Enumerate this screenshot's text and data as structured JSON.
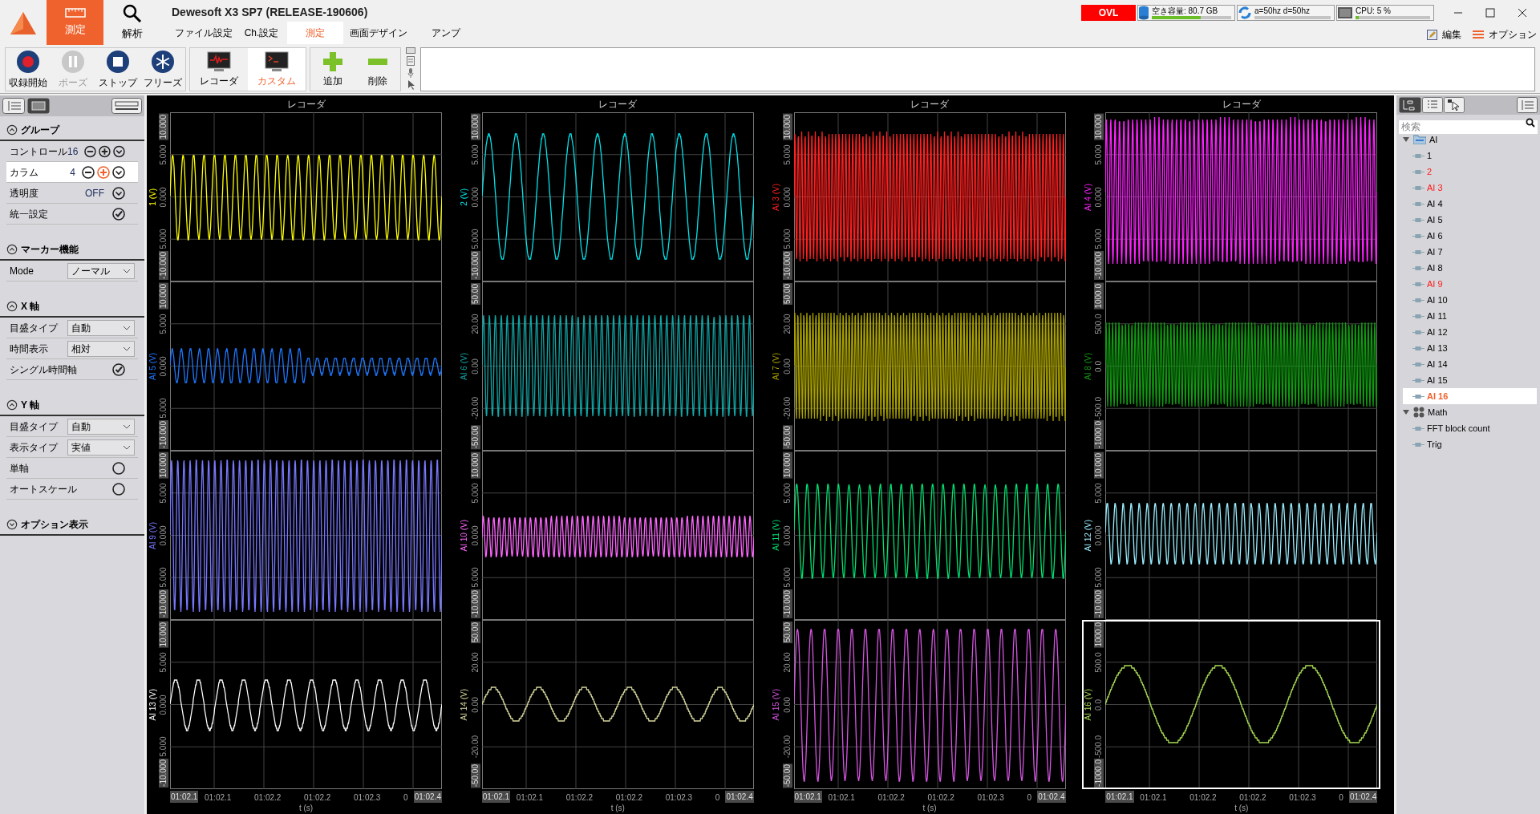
{
  "app_tabs": [
    {
      "kind": "measure",
      "label": "測定",
      "selected": true
    },
    {
      "kind": "analysis",
      "label": "解析",
      "selected": false
    }
  ],
  "window": {
    "title": "Dewesoft X3 SP7 (RELEASE-190606)"
  },
  "menu_tabs": [
    {
      "label": "ファイル設定",
      "selected": false
    },
    {
      "label": "Ch.設定",
      "selected": false
    },
    {
      "label": "測定",
      "selected": true
    },
    {
      "label": "画面デザイン",
      "selected": false
    },
    {
      "label": "アンプ",
      "selected": false
    }
  ],
  "status": {
    "alarm": "OVL",
    "meters": [
      {
        "kind": "disk",
        "label": "空き容量: 80.7 GB",
        "level": 0.62
      },
      {
        "kind": "sync",
        "label": "a=50hz d=50hz",
        "level": 0
      },
      {
        "kind": "cpu",
        "label": "CPU: 5 %",
        "level": 0.04
      }
    ]
  },
  "top_actions": [
    {
      "kind": "edit",
      "label": "編集"
    },
    {
      "kind": "options",
      "label": "オプション"
    }
  ],
  "toolbar": {
    "acquisition": [
      {
        "kind": "record",
        "label": "収録開始",
        "disabled": false
      },
      {
        "kind": "pause",
        "label": "ポーズ",
        "disabled": true
      },
      {
        "kind": "stop",
        "label": "ストップ",
        "disabled": false
      },
      {
        "kind": "freeze",
        "label": "フリーズ",
        "disabled": false
      }
    ],
    "layouts": [
      {
        "kind": "recorder",
        "label": "レコーダ",
        "selected": false
      },
      {
        "kind": "custom",
        "label": "カスタム",
        "selected": true
      }
    ],
    "edit": [
      {
        "kind": "add",
        "label": "追加"
      },
      {
        "kind": "remove",
        "label": "削除"
      }
    ]
  },
  "settings": [
    {
      "title": "グループ",
      "expanded": true,
      "rows": [
        {
          "kind": "stepper",
          "label": "コントロール",
          "value": "16",
          "selected": false
        },
        {
          "kind": "stepper",
          "label": "カラム",
          "value": "4",
          "selected": true
        },
        {
          "kind": "dropdown",
          "label": "透明度",
          "value": "OFF"
        },
        {
          "kind": "check",
          "label": "統一設定",
          "checked": true
        }
      ]
    },
    {
      "title": "マーカー機能",
      "expanded": true,
      "rows": [
        {
          "kind": "select",
          "label": "Mode",
          "value": "ノーマル"
        }
      ]
    },
    {
      "title": "X 軸",
      "expanded": true,
      "rows": [
        {
          "kind": "select",
          "label": "目盛タイプ",
          "value": "自動"
        },
        {
          "kind": "select",
          "label": "時間表示",
          "value": "相対"
        },
        {
          "kind": "check",
          "label": "シングル時間軸",
          "checked": true
        }
      ]
    },
    {
      "title": "Y 軸",
      "expanded": true,
      "rows": [
        {
          "kind": "select",
          "label": "目盛タイプ",
          "value": "自動"
        },
        {
          "kind": "select",
          "label": "表示タイプ",
          "value": "実値"
        },
        {
          "kind": "check",
          "label": "単軸",
          "checked": false
        },
        {
          "kind": "check",
          "label": "オートスケール",
          "checked": false
        }
      ]
    },
    {
      "title": "オプション表示",
      "expanded": false
    }
  ],
  "columns": [
    {
      "title": "レコーダ",
      "plots": [
        {
          "label": "1 (V)",
          "color": "#ffff00",
          "ticks": [
            "10.000",
            "5.000",
            "0.000",
            "5.000",
            "-10.000"
          ],
          "selected": false
        },
        {
          "label": "AI 5 (V)",
          "color": "#1e78ff",
          "ticks": [
            "10.000",
            "5.000",
            "0.000",
            "5.000",
            "-10.000"
          ],
          "selected": false
        },
        {
          "label": "AI 9 (V)",
          "color": "#7878ff",
          "ticks": [
            "10.000",
            "5.000",
            "0.000",
            "5.000",
            "-10.000"
          ],
          "selected": false
        },
        {
          "label": "AI 13 (V)",
          "color": "#ffffff",
          "ticks": [
            "10.000",
            "5.000",
            "0.000",
            "5.000",
            "-10.000"
          ],
          "selected": false
        }
      ],
      "time_start": "01:02.1",
      "time_ticks": [
        "01:02.1",
        "01:02.2",
        "01:02.2",
        "01:02.3",
        "0"
      ],
      "time_end": "01:02.4",
      "time_label": "t (s)"
    },
    {
      "title": "レコーダ",
      "plots": [
        {
          "label": "2 (V)",
          "color": "#00e5ee",
          "ticks": [
            "10.000",
            "5.000",
            "0.000",
            "5.000",
            "-10.000"
          ],
          "selected": false
        },
        {
          "label": "AI 6 (V)",
          "color": "#12a5a5",
          "ticks": [
            "50.00",
            "20.00",
            "0.00",
            "-20.00",
            "-50.00"
          ],
          "selected": false
        },
        {
          "label": "AI 10 (V)",
          "color": "#ff66ff",
          "ticks": [
            "10.000",
            "5.000",
            "0.000",
            "5.000",
            "-10.000"
          ],
          "selected": false
        },
        {
          "label": "AI 14 (V)",
          "color": "#d8d8a0",
          "ticks": [
            "50.00",
            "20.00",
            "0.00",
            "-20.00",
            "-50.00"
          ],
          "selected": false
        }
      ],
      "time_start": "01:02.1",
      "time_ticks": [
        "01:02.1",
        "01:02.2",
        "01:02.2",
        "01:02.3",
        "0"
      ],
      "time_end": "01:02.4",
      "time_label": "t (s)"
    },
    {
      "title": "レコーダ",
      "plots": [
        {
          "label": "AI 3 (V)",
          "color": "#ff2020",
          "ticks": [
            "10.000",
            "5.000",
            "0.000",
            "5.000",
            "-10.000"
          ],
          "selected": false
        },
        {
          "label": "AI 7 (V)",
          "color": "#a8a000",
          "ticks": [
            "50.00",
            "20.00",
            "0.00",
            "-20.00",
            "-50.00"
          ],
          "selected": false
        },
        {
          "label": "AI 11 (V)",
          "color": "#00e070",
          "ticks": [
            "10.000",
            "5.000",
            "0.000",
            "5.000",
            "-10.000"
          ],
          "selected": false
        },
        {
          "label": "AI 15 (V)",
          "color": "#d455e0",
          "ticks": [
            "50.00",
            "20.00",
            "0.00",
            "-20.00",
            "-50.00"
          ],
          "selected": false
        }
      ],
      "time_start": "01:02.1",
      "time_ticks": [
        "01:02.1",
        "01:02.2",
        "01:02.2",
        "01:02.3",
        "0"
      ],
      "time_end": "01:02.4",
      "time_label": "t (s)"
    },
    {
      "title": "レコーダ",
      "plots": [
        {
          "label": "AI 4 (V)",
          "color": "#ff22ff",
          "ticks": [
            "10.000",
            "5.000",
            "0.000",
            "5.000",
            "-10.000"
          ],
          "selected": false
        },
        {
          "label": "AI 8 (V)",
          "color": "#119a11",
          "ticks": [
            "1000.0",
            "500.0",
            "0.0",
            "-500.0",
            "-1000.0"
          ],
          "selected": false
        },
        {
          "label": "AI 12 (V)",
          "color": "#99eeff",
          "ticks": [
            "10.000",
            "5.000",
            "0.000",
            "5.000",
            "-10.000"
          ],
          "selected": false
        },
        {
          "label": "AI 16 (V)",
          "color": "#aadd55",
          "ticks": [
            "1000.0",
            "500.0",
            "0.0",
            "-500.0",
            "-1000.0"
          ],
          "selected": true
        }
      ],
      "time_start": "01:02.1",
      "time_ticks": [
        "01:02.1",
        "01:02.2",
        "01:02.2",
        "01:02.3",
        "0"
      ],
      "time_end": "01:02.4",
      "time_label": "t (s)"
    }
  ],
  "channel_tree": {
    "search": {
      "placeholder": "検索"
    },
    "nodes": [
      {
        "kind": "folder",
        "label": "AI",
        "expanded": true,
        "children": [
          {
            "kind": "channel",
            "label": "1",
            "warning": false,
            "selected": false
          },
          {
            "kind": "channel",
            "label": "2",
            "warning": true,
            "selected": false
          },
          {
            "kind": "channel",
            "label": "AI 3",
            "warning": true,
            "selected": false
          },
          {
            "kind": "channel",
            "label": "AI 4",
            "warning": false,
            "selected": false
          },
          {
            "kind": "channel",
            "label": "AI 5",
            "warning": false,
            "selected": false
          },
          {
            "kind": "channel",
            "label": "AI 6",
            "warning": false,
            "selected": false
          },
          {
            "kind": "channel",
            "label": "AI 7",
            "warning": false,
            "selected": false
          },
          {
            "kind": "channel",
            "label": "AI 8",
            "warning": false,
            "selected": false
          },
          {
            "kind": "channel",
            "label": "AI 9",
            "warning": true,
            "selected": false
          },
          {
            "kind": "channel",
            "label": "AI 10",
            "warning": false,
            "selected": false
          },
          {
            "kind": "channel",
            "label": "AI 11",
            "warning": false,
            "selected": false
          },
          {
            "kind": "channel",
            "label": "AI 12",
            "warning": false,
            "selected": false
          },
          {
            "kind": "channel",
            "label": "AI 13",
            "warning": false,
            "selected": false
          },
          {
            "kind": "channel",
            "label": "AI 14",
            "warning": false,
            "selected": false
          },
          {
            "kind": "channel",
            "label": "AI 15",
            "warning": false,
            "selected": false
          },
          {
            "kind": "channel",
            "label": "AI 16",
            "warning": false,
            "selected": true
          }
        ]
      },
      {
        "kind": "math",
        "label": "Math",
        "expanded": true,
        "children": [
          {
            "kind": "channel",
            "label": "FFT block count",
            "warning": false,
            "selected": false
          },
          {
            "kind": "channel",
            "label": "Trig",
            "warning": false,
            "selected": false
          }
        ]
      }
    ]
  }
}
